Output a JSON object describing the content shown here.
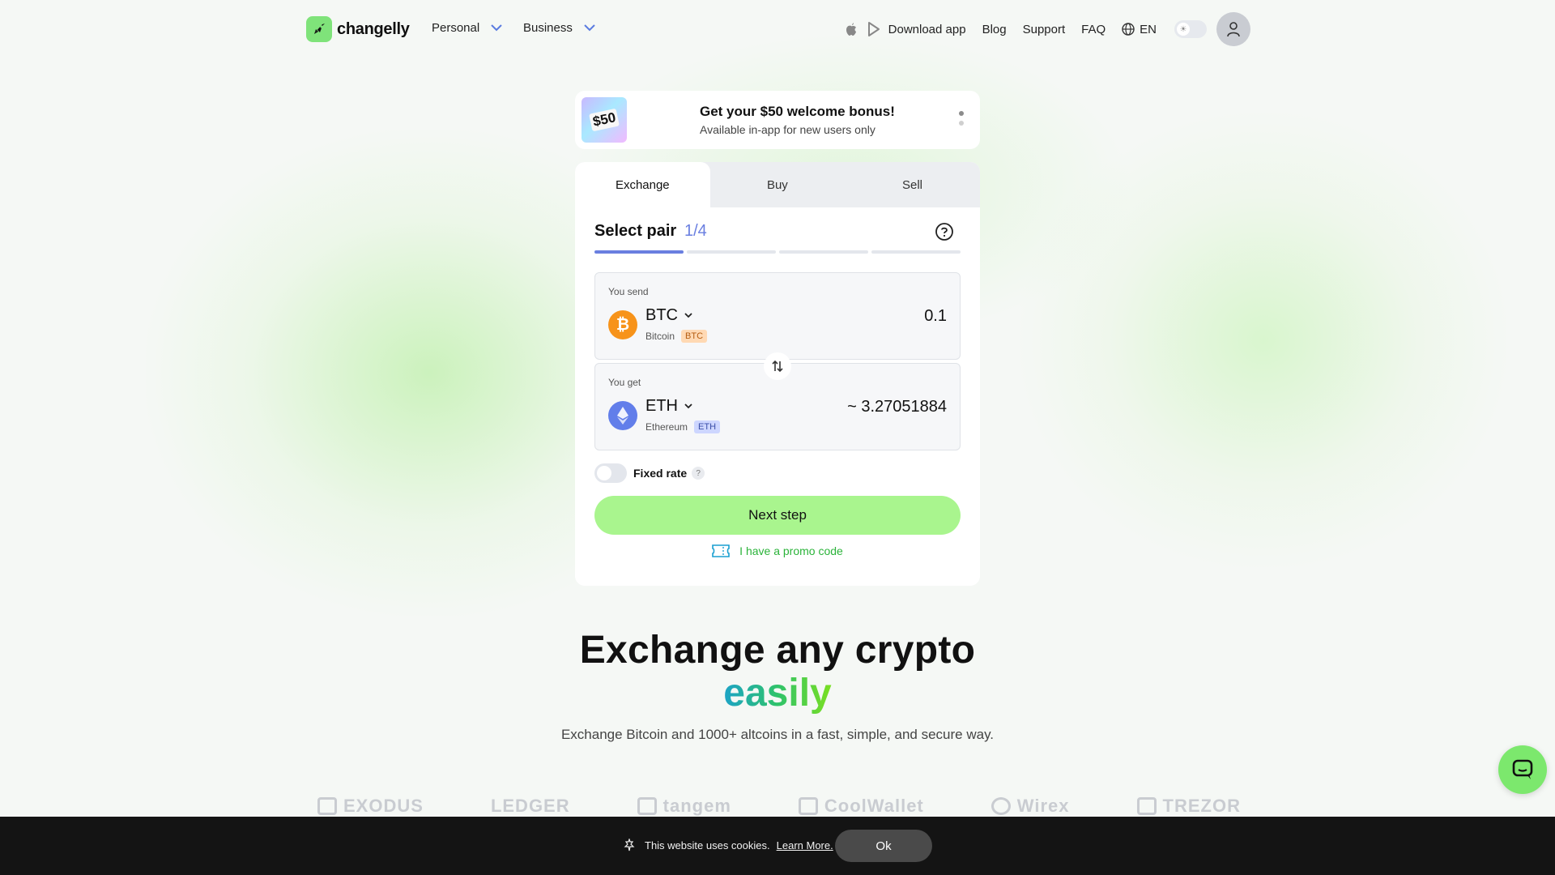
{
  "header": {
    "logo_text": "changelly",
    "nav": [
      {
        "label": "Personal"
      },
      {
        "label": "Business"
      }
    ],
    "download_label": "Download app",
    "blog_label": "Blog",
    "support_label": "Support",
    "faq_label": "FAQ",
    "language": "EN"
  },
  "promo": {
    "image_text": "$50",
    "title": "Get your $50 welcome bonus!",
    "subtitle": "Available in-app for new users only"
  },
  "exchange": {
    "tabs": [
      {
        "label": "Exchange",
        "active": true
      },
      {
        "label": "Buy",
        "active": false
      },
      {
        "label": "Sell",
        "active": false
      }
    ],
    "step_title": "Select pair",
    "step_count": "1/4",
    "progress": {
      "current": 1,
      "total": 4
    },
    "send": {
      "label": "You send",
      "ticker": "BTC",
      "name": "Bitcoin",
      "badge": "BTC",
      "amount": "0.1",
      "icon": "bitcoin-icon",
      "color": "#f7931a"
    },
    "get": {
      "label": "You get",
      "ticker": "ETH",
      "name": "Ethereum",
      "badge": "ETH",
      "amount": "~ 3.27051884",
      "icon": "ethereum-icon",
      "color": "#627eea"
    },
    "fixed_rate_label": "Fixed rate",
    "fixed_rate_help": "?",
    "next_label": "Next step",
    "promo_code_label": "I have a promo code"
  },
  "hero": {
    "title": "Exchange any crypto",
    "accent": "easily",
    "subtitle": "Exchange Bitcoin and 1000+ altcoins in a fast, simple, and secure way."
  },
  "partners": [
    "EXODUS",
    "LEDGER",
    "tangem",
    "CoolWallet",
    "Wirex",
    "TREZOR"
  ],
  "cookie": {
    "text": "This website uses cookies.",
    "learn_more": "Learn More.",
    "ok_label": "Ok"
  },
  "colors": {
    "accent_green": "#a9f58e",
    "step_blue": "#6a7fe0",
    "promo_link": "#2bb33a"
  }
}
